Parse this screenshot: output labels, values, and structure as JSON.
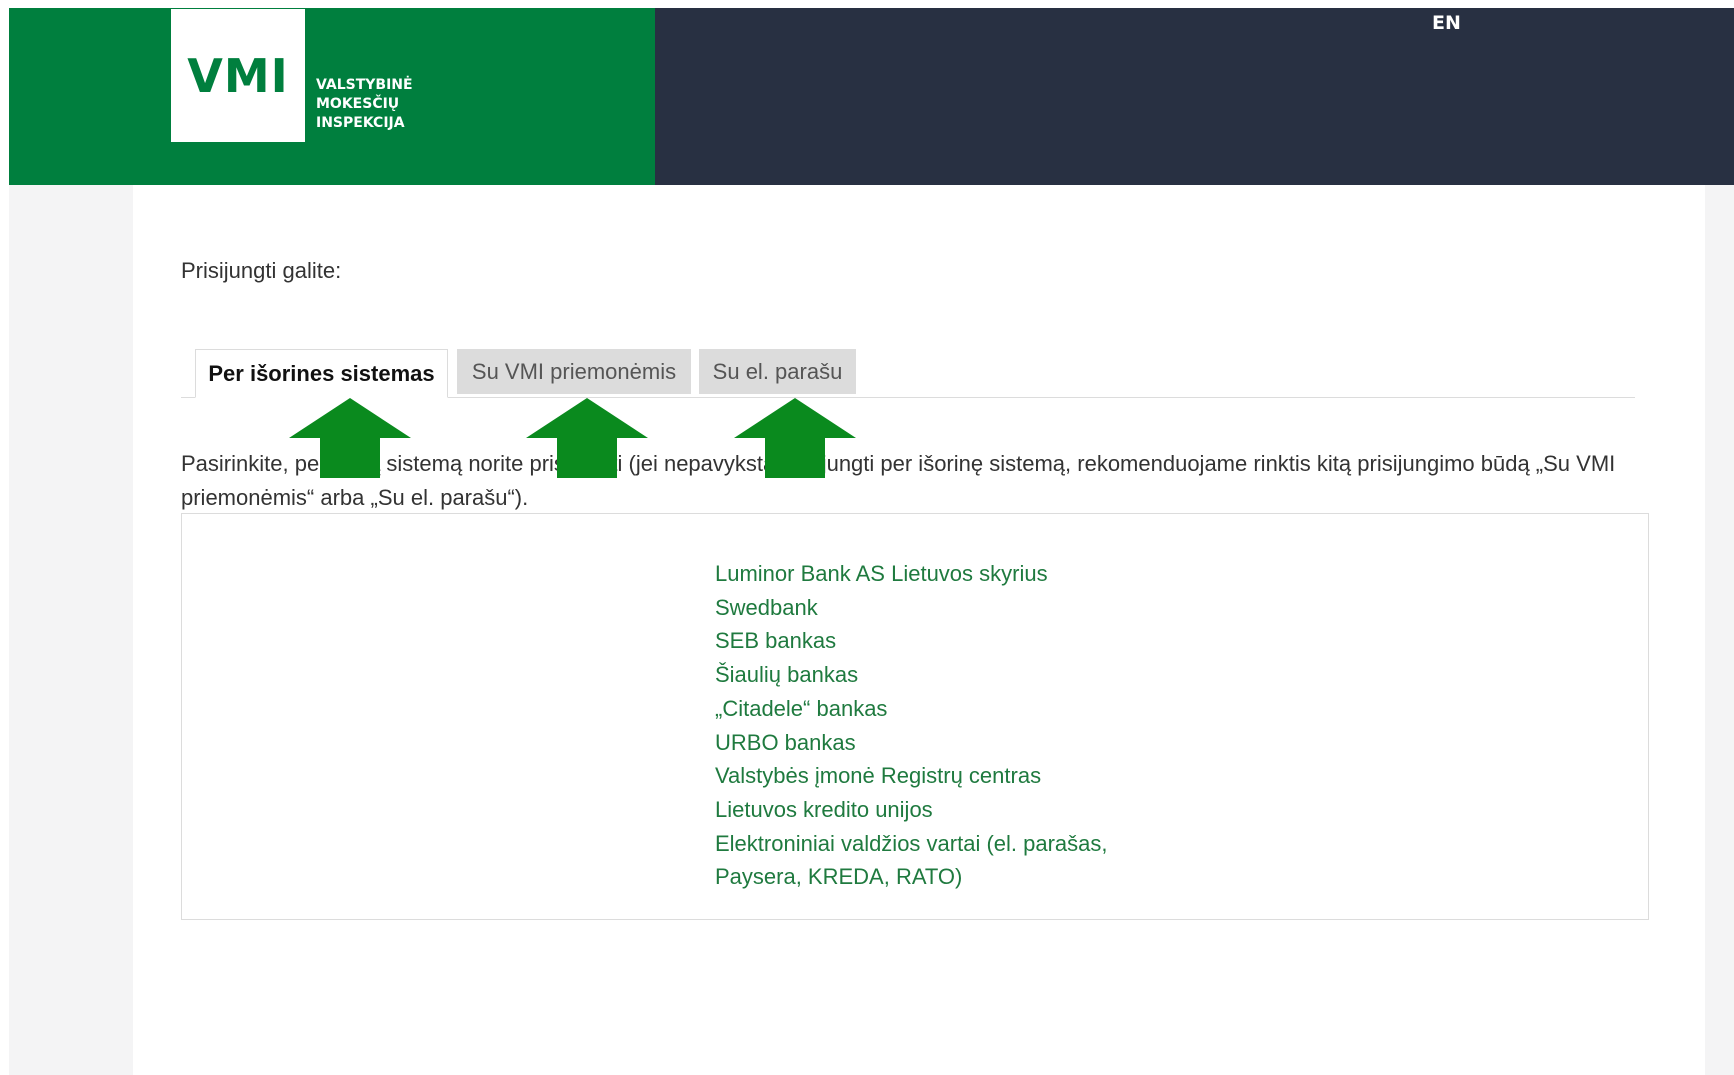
{
  "header": {
    "logo_text": "VMI",
    "logo_caption": [
      "VALSTYBINĖ",
      "MOKESČIŲ",
      "INSPEKCIJA"
    ],
    "lang_link": "EN",
    "colors": {
      "brand_green": "#007f3e",
      "dark_bar": "#283042"
    }
  },
  "main": {
    "intro": "Prisijungti galite:",
    "tabs": [
      {
        "label": "Per išorines sistemas",
        "active": true
      },
      {
        "label": "Su VMI priemonėmis",
        "active": false
      },
      {
        "label": "Su el. parašu",
        "active": false
      }
    ],
    "description": "Pasirinkite, per kurią sistemą norite prisijungti (jei nepavyksta prisijungti per išorinę sistemą, rekomenduojame rinktis kitą prisijungimo būdą „Su VMI priemonėmis“ arba „Su el. parašu“).",
    "providers": [
      "Luminor Bank AS Lietuvos skyrius",
      "Swedbank",
      "SEB bankas",
      "Šiaulių bankas",
      "„Citadele“ bankas",
      "URBO bankas",
      "Valstybės įmonė Registrų centras",
      "Lietuvos kredito unijos",
      "Elektroniniai valdžios vartai (el. parašas,",
      "Paysera, KREDA, RATO)"
    ],
    "link_color": "#1f7a3f"
  },
  "overlay": {
    "arrow_icon": "up-arrow-icon",
    "arrow_color": "#0a8a1e"
  }
}
